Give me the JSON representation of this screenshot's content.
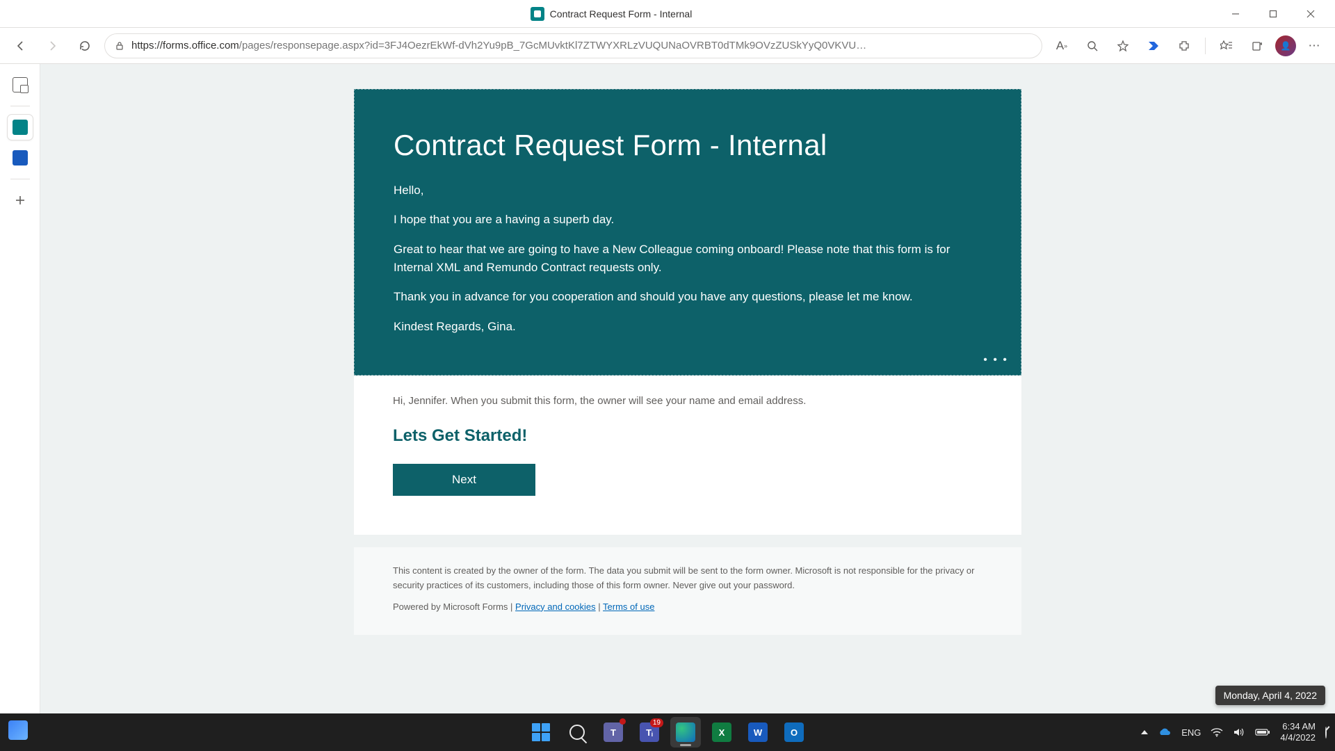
{
  "window": {
    "title": "Contract Request Form - Internal"
  },
  "browser": {
    "url_host": "forms.office.com",
    "url_path": "/pages/responsepage.aspx?id=3FJ4OezrEkWf-dVh2Yu9pB_7GcMUvktKl7ZTWYXRLzVUQUNaOVRBT0dTMk9OVzZUSkYyQ0VKVU…"
  },
  "form": {
    "title": "Contract Request Form - Internal",
    "greeting": "Hello,",
    "line1": "I hope that you are a having a superb day.",
    "line2": "Great to hear that we are going to have a New Colleague coming onboard! Please note that this form is for Internal XML and Remundo Contract requests only.",
    "line3": "Thank you in advance for you cooperation and should you have any questions, please let me know.",
    "signoff": "Kindest Regards, Gina.",
    "submit_notice": "Hi, Jennifer. When you submit this form, the owner will see your name and email address.",
    "section_heading": "Lets Get Started!",
    "next_label": "Next"
  },
  "footer": {
    "disclaimer": "This content is created by the owner of the form. The data you submit will be sent to the form owner. Microsoft is not responsible for the privacy or security practices of its customers, including those of this form owner. Never give out your password.",
    "powered_by": "Powered by Microsoft Forms",
    "privacy_label": "Privacy and cookies",
    "terms_label": "Terms of use",
    "sep": " | "
  },
  "tooltip": {
    "text": "Monday, April 4, 2022"
  },
  "tray": {
    "lang": "ENG",
    "time": "6:34 AM",
    "date": "4/4/2022"
  },
  "taskbar": {
    "teams_badge": "19"
  }
}
